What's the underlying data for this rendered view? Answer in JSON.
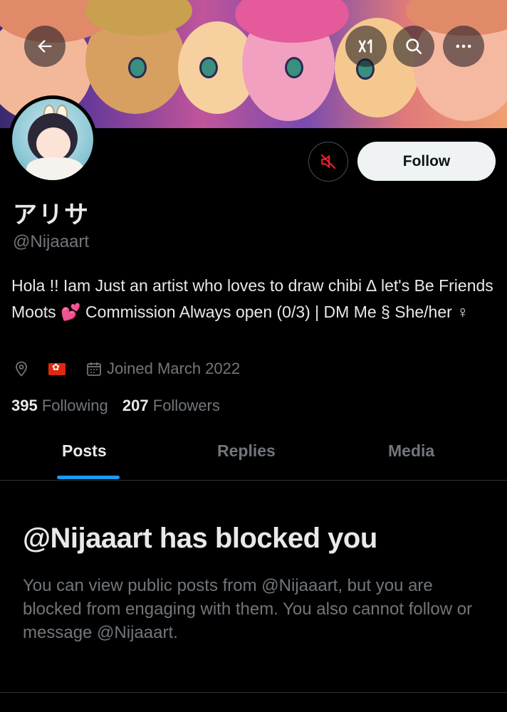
{
  "profile": {
    "display_name": "アリサ",
    "handle": "@Nijaaart",
    "bio_part1": "Hola !! Iam Just an artist who loves to draw chibi ∆ let's Be Friends Moots ",
    "bio_heart": "💕",
    "bio_part2": " Commission Always open (0/3) | DM Me § She/her ♀",
    "joined": "Joined March 2022"
  },
  "stats": {
    "following_count": "395",
    "following_label": "Following",
    "followers_count": "207",
    "followers_label": "Followers"
  },
  "actions": {
    "follow_label": "Follow"
  },
  "tabs": [
    {
      "label": "Posts",
      "active": true
    },
    {
      "label": "Replies",
      "active": false
    },
    {
      "label": "Media",
      "active": false
    }
  ],
  "blocked": {
    "title": "@Nijaaart has blocked you",
    "description": "You can view public posts from @Nijaaart, but you are blocked from engaging with them. You also cannot follow or message @Nijaaart."
  },
  "icons": {
    "back": "back-arrow-icon",
    "grok": "grok-icon",
    "search": "search-icon",
    "more": "more-icon",
    "mute": "muted-speaker-icon",
    "location": "location-pin-icon",
    "calendar": "calendar-icon"
  },
  "colors": {
    "background": "#000000",
    "text": "#e7e9ea",
    "secondary_text": "#71767b",
    "accent": "#1d9bf0",
    "mute_red": "#f4212e"
  }
}
